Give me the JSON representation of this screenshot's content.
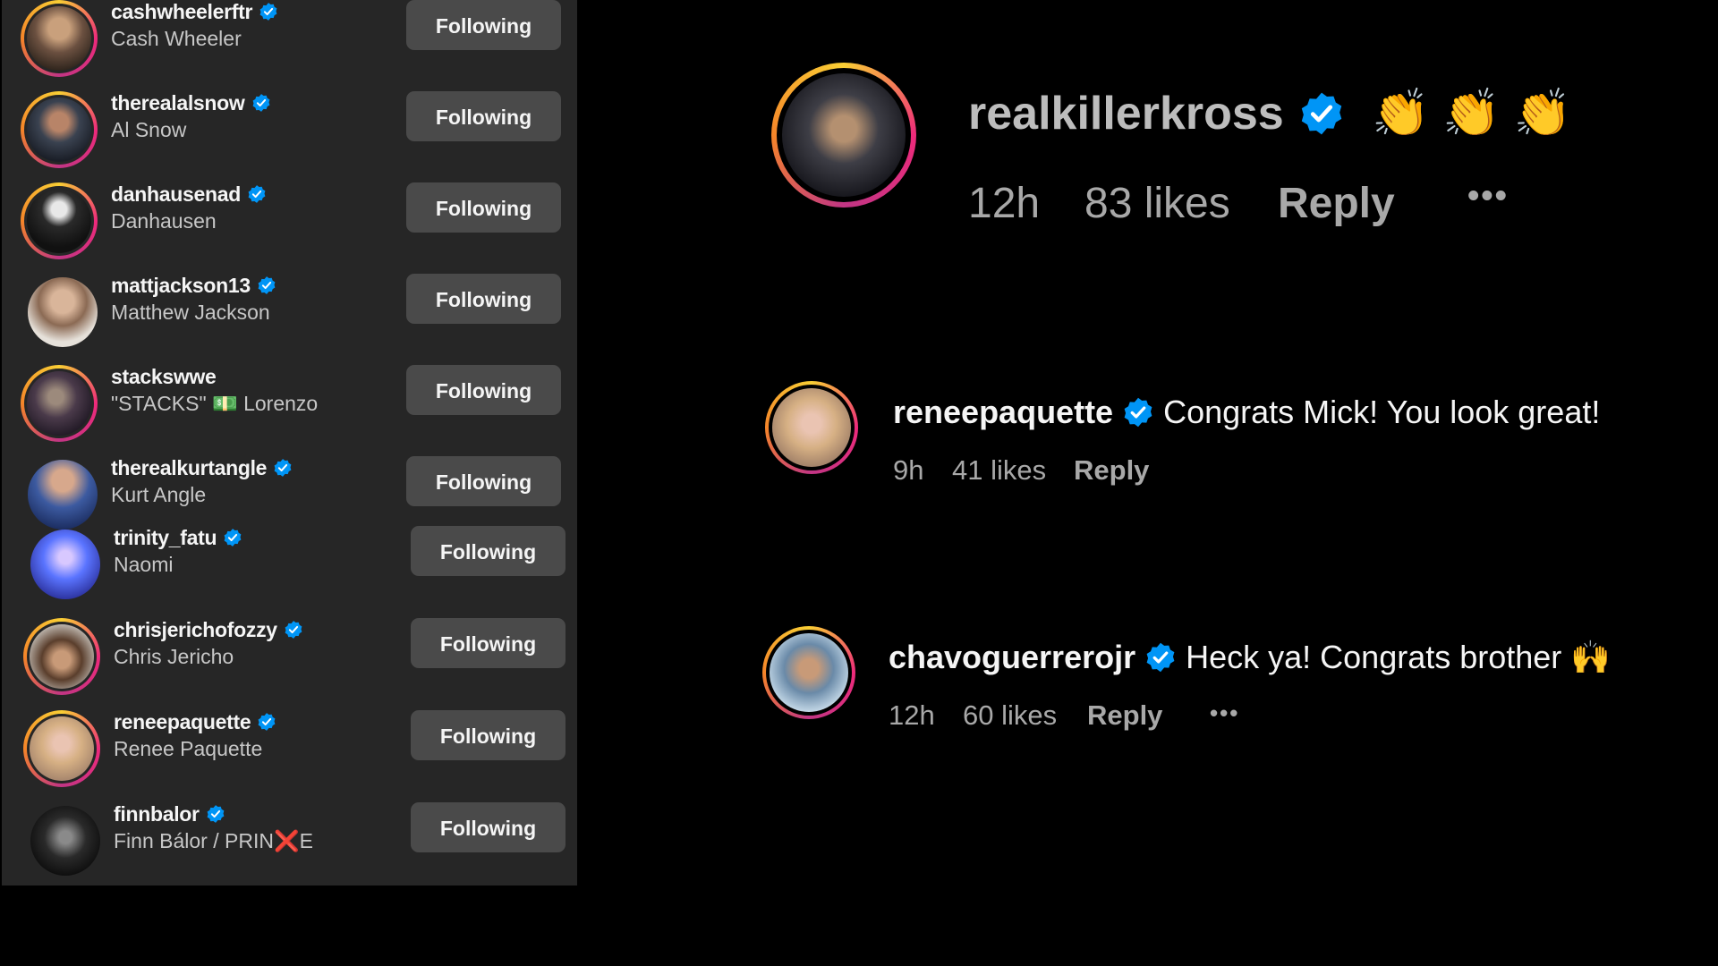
{
  "following": [
    {
      "username": "cashwheelerftr",
      "display_name": "Cash Wheeler",
      "verified": true,
      "button": "Following"
    },
    {
      "username": "therealalsnow",
      "display_name": "Al Snow",
      "verified": true,
      "button": "Following"
    },
    {
      "username": "danhausenad",
      "display_name": "Danhausen",
      "verified": true,
      "button": "Following"
    },
    {
      "username": "mattjackson13",
      "display_name": "Matthew Jackson",
      "verified": true,
      "button": "Following"
    },
    {
      "username": "stackswwe",
      "display_name_before": "\"STACKS\"",
      "display_name_emoji": "💵",
      "display_name_after": "Lorenzo",
      "verified": false,
      "button": "Following"
    },
    {
      "username": "therealkurtangle",
      "display_name": "Kurt Angle",
      "verified": true,
      "button": "Following"
    },
    {
      "username": "trinity_fatu",
      "display_name": "Naomi",
      "verified": true,
      "button": "Following"
    },
    {
      "username": "chrisjerichofozzy",
      "display_name": "Chris Jericho",
      "verified": true,
      "button": "Following"
    },
    {
      "username": "reneepaquette",
      "display_name": "Renee Paquette",
      "verified": true,
      "button": "Following"
    },
    {
      "username": "finnbalor",
      "display_name_before": "Finn Bálor / PRIN",
      "display_name_emoji": "❌",
      "display_name_after": "E",
      "verified": true,
      "button": "Following"
    }
  ],
  "comments": [
    {
      "username": "realkillerkross",
      "text": "👏 👏 👏",
      "time": "12h",
      "likes": "83 likes",
      "reply": "Reply",
      "more": "•••"
    },
    {
      "username": "reneepaquette",
      "text": "Congrats Mick! You look great!",
      "time": "9h",
      "likes": "41 likes",
      "reply": "Reply"
    },
    {
      "username": "chavoguerrerojr",
      "text": "Heck ya! Congrats brother 🙌",
      "time": "12h",
      "likes": "60 likes",
      "reply": "Reply",
      "more": "•••"
    }
  ],
  "colors": {
    "panel_bg": "#262626",
    "button_bg": "#4a4a4a",
    "verified_blue": "#0095f6",
    "meta_gray": "#a8a8a8"
  }
}
